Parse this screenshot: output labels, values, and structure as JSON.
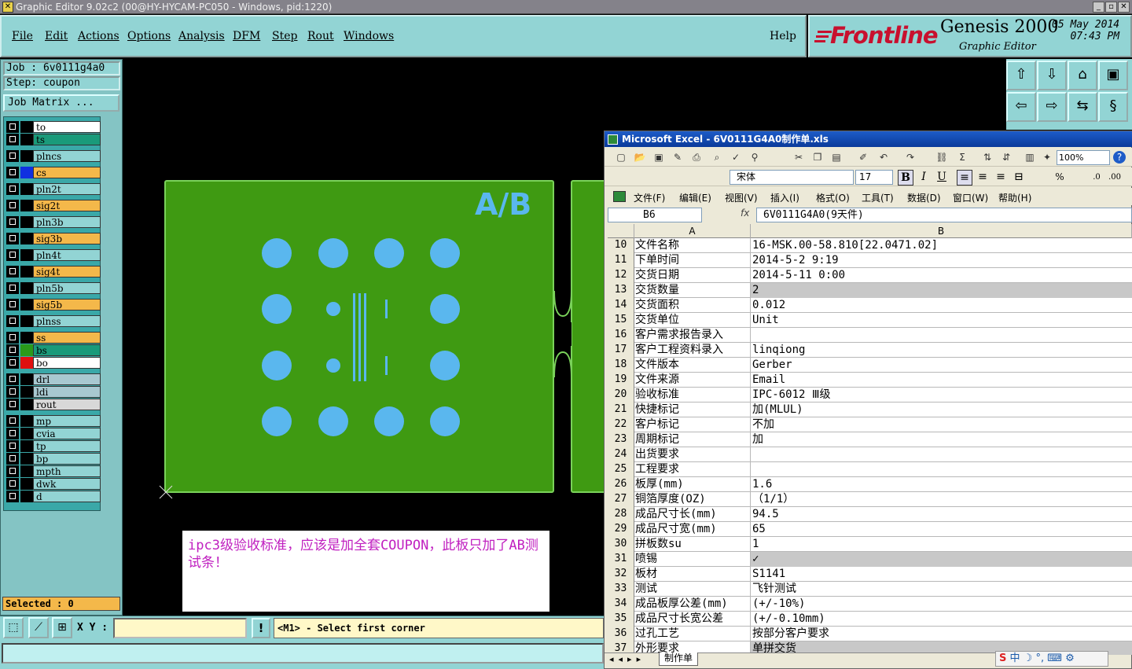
{
  "window": {
    "title": "Graphic Editor 9.02c2 (00@HY-HYCAM-PC050 - Windows, pid:1220)"
  },
  "menus": [
    "File",
    "Edit",
    "Actions",
    "Options",
    "Analysis",
    "DFM",
    "Step",
    "Rout",
    "Windows"
  ],
  "help": "Help",
  "brand": {
    "logo": "Frontline",
    "product": "Genesis 2000",
    "subtitle": "Graphic Editor",
    "date": "05 May 2014",
    "time": "07:43 PM"
  },
  "job": {
    "label": "Job : 6v0111g4a0",
    "step": "Step: coupon",
    "matrix_button": "Job Matrix ..."
  },
  "layers": [
    {
      "name": "to",
      "color": "#ffffff"
    },
    {
      "name": "ts",
      "color": "#1a9a7a"
    },
    {
      "name": "plncs",
      "color": "#92d4d4"
    },
    {
      "name": "cs",
      "color": "#f4b84a",
      "swatch": "#1030e0"
    },
    {
      "name": "pln2t",
      "color": "#92d4d4"
    },
    {
      "name": "sig2t",
      "color": "#f4b84a"
    },
    {
      "name": "pln3b",
      "color": "#92d4d4"
    },
    {
      "name": "sig3b",
      "color": "#f4b84a"
    },
    {
      "name": "pln4t",
      "color": "#92d4d4"
    },
    {
      "name": "sig4t",
      "color": "#f4b84a"
    },
    {
      "name": "pln5b",
      "color": "#92d4d4"
    },
    {
      "name": "sig5b",
      "color": "#f4b84a"
    },
    {
      "name": "plnss",
      "color": "#92d4d4"
    },
    {
      "name": "ss",
      "color": "#f4b84a"
    },
    {
      "name": "bs",
      "color": "#1a9a7a",
      "swatch": "#2a9a1a"
    },
    {
      "name": "bo",
      "color": "#ffffff",
      "swatch": "#e01010"
    },
    {
      "name": "drl",
      "color": "#a8c8d0"
    },
    {
      "name": "ldi",
      "color": "#a8c8d0"
    },
    {
      "name": "rout",
      "color": "#d8d8d8"
    },
    {
      "name": "mp",
      "color": "#92d4d4"
    },
    {
      "name": "cvia",
      "color": "#92d4d4"
    },
    {
      "name": "tp",
      "color": "#92d4d4"
    },
    {
      "name": "bp",
      "color": "#92d4d4"
    },
    {
      "name": "mpth",
      "color": "#92d4d4"
    },
    {
      "name": "dwk",
      "color": "#92d4d4"
    },
    {
      "name": "d",
      "color": "#92d4d4"
    }
  ],
  "selected": "Selected : 0",
  "canvas": {
    "board_label": "A/B"
  },
  "note": "ipc3级验收标准，应该是加全套COUPON，此板只加了AB测试条！",
  "bottom": {
    "xy_label": "X Y :",
    "xy_value": "",
    "bang": "!",
    "prompt": "<M1> - Select first corner"
  },
  "colors": {
    "panel": "#92d4d4",
    "board": "#3f9a12",
    "pad": "#5ab7ee",
    "note_text": "#c020c0"
  },
  "excel": {
    "title": "Microsoft Excel - 6V0111G4A0制作单.xls",
    "font": "宋体",
    "size": "17",
    "zoom": "100%",
    "menus": [
      "文件(F)",
      "编辑(E)",
      "视图(V)",
      "插入(I)",
      "格式(O)",
      "工具(T)",
      "数据(D)",
      "窗口(W)",
      "帮助(H)"
    ],
    "name_box": "B6",
    "fx": "fx",
    "formula": "6V0111G4A0(9天件)",
    "col_a": "A",
    "col_b": "B",
    "rows": [
      {
        "n": "10",
        "a": "文件名称",
        "b": "16-MSK.00-58.810[22.0471.02]"
      },
      {
        "n": "11",
        "a": "下单时间",
        "b": "2014-5-2 9:19"
      },
      {
        "n": "12",
        "a": "交货日期",
        "b": "2014-5-11 0:00"
      },
      {
        "n": "13",
        "a": "交货数量",
        "b": "2",
        "grey": true
      },
      {
        "n": "14",
        "a": "交货面积",
        "b": "0.012"
      },
      {
        "n": "15",
        "a": "交货单位",
        "b": "Unit"
      },
      {
        "n": "16",
        "a": "客户需求报告录入",
        "b": ""
      },
      {
        "n": "17",
        "a": "客户工程资料录入",
        "b": "linqiong"
      },
      {
        "n": "18",
        "a": "文件版本",
        "b": "Gerber"
      },
      {
        "n": "19",
        "a": "文件来源",
        "b": "Email"
      },
      {
        "n": "20",
        "a": "验收标准",
        "b": "IPC-6012 Ⅲ级"
      },
      {
        "n": "21",
        "a": "快捷标记",
        "b": "加(MLUL)"
      },
      {
        "n": "22",
        "a": "客户标记",
        "b": "不加"
      },
      {
        "n": "23",
        "a": "周期标记",
        "b": "加"
      },
      {
        "n": "24",
        "a": "出货要求",
        "b": ""
      },
      {
        "n": "25",
        "a": "工程要求",
        "b": ""
      },
      {
        "n": "26",
        "a": "板厚(mm)",
        "b": "1.6"
      },
      {
        "n": "27",
        "a": "铜箔厚度(OZ)",
        "b": "（1/1）"
      },
      {
        "n": "28",
        "a": "成品尺寸长(mm)",
        "b": "94.5"
      },
      {
        "n": "29",
        "a": "成品尺寸宽(mm)",
        "b": "65"
      },
      {
        "n": "30",
        "a": "拼板数su",
        "b": "1"
      },
      {
        "n": "31",
        "a": "喷锡",
        "b": "✓",
        "grey": true
      },
      {
        "n": "32",
        "a": "板材",
        "b": "S1141"
      },
      {
        "n": "33",
        "a": "测试",
        "b": "飞针测试"
      },
      {
        "n": "34",
        "a": "成品板厚公差(mm)",
        "b": "(+/-10%)"
      },
      {
        "n": "35",
        "a": "成品尺寸长宽公差",
        "b": "(+/-0.10mm)"
      },
      {
        "n": "36",
        "a": "过孔工艺",
        "b": "按部分客户要求"
      },
      {
        "n": "37",
        "a": "外形要求",
        "b": "单拼交货",
        "grey": true
      }
    ],
    "sheet_tab": "制作单",
    "ime": "中"
  }
}
